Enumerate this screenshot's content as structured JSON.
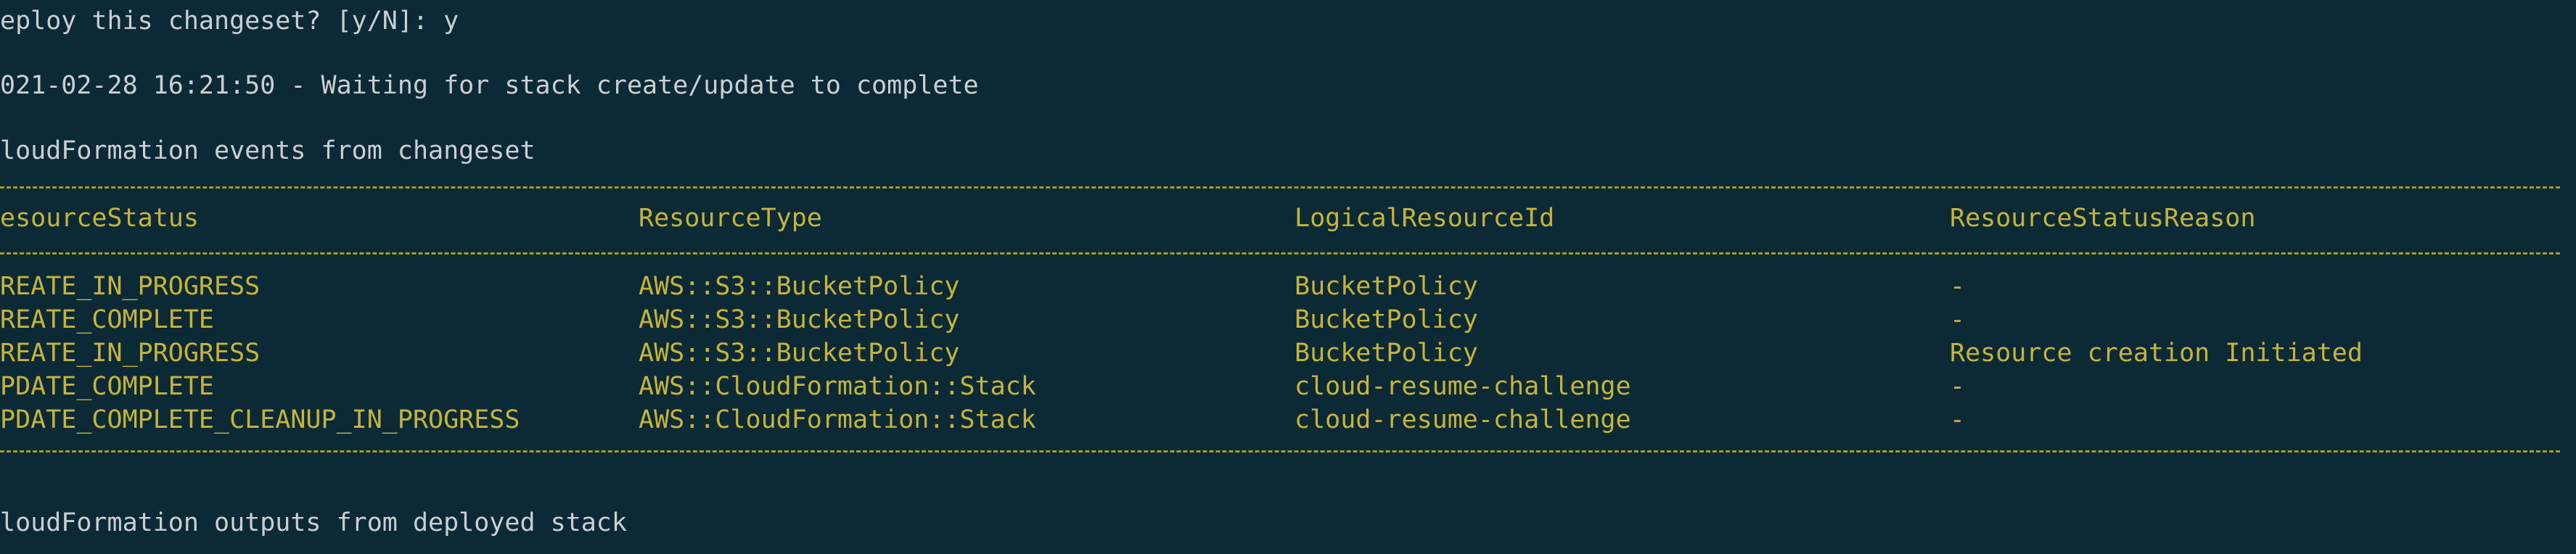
{
  "terminal": {
    "prompt_line": "eploy this changeset? [y/N]: y",
    "waiting_line": "021-02-28 16:21:50 - Waiting for stack create/update to complete",
    "events_heading": "loudFormation events from changeset",
    "outputs_heading": "loudFormation outputs from deployed stack"
  },
  "events_table": {
    "headers": [
      "esourceStatus",
      "ResourceType",
      "LogicalResourceId",
      "ResourceStatusReason"
    ],
    "rows": [
      [
        "REATE_IN_PROGRESS",
        "AWS::S3::BucketPolicy",
        "BucketPolicy",
        "-"
      ],
      [
        "REATE_COMPLETE",
        "AWS::S3::BucketPolicy",
        "BucketPolicy",
        "-"
      ],
      [
        "REATE_IN_PROGRESS",
        "AWS::S3::BucketPolicy",
        "BucketPolicy",
        "Resource creation Initiated"
      ],
      [
        "PDATE_COMPLETE",
        "AWS::CloudFormation::Stack",
        "cloud-resume-challenge",
        "-"
      ],
      [
        "PDATE_COMPLETE_CLEANUP_IN_PROGRESS",
        "AWS::CloudFormation::Stack",
        "cloud-resume-challenge",
        "-"
      ]
    ]
  },
  "colors": {
    "background": "#0c2a35",
    "text": "#c9cfd3",
    "table_text": "#c6b43a",
    "divider": "#a99a2e"
  }
}
